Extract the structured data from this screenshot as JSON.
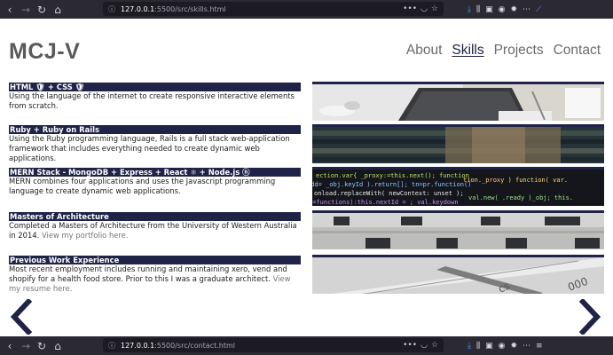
{
  "browser_top": {
    "url_host": "127.0.0.1",
    "url_path": ":5500/src/skills.html"
  },
  "browser_bottom": {
    "url_host": "127.0.0.1",
    "url_path": ":5500/src/contact.html"
  },
  "header": {
    "logo": "MCJ-V"
  },
  "nav": [
    {
      "label": "About"
    },
    {
      "label": "Skills",
      "active": true
    },
    {
      "label": "Projects"
    },
    {
      "label": "Contact"
    }
  ],
  "skills": [
    {
      "title": "HTML 🛡 + CSS 🛡",
      "desc": "Using the language of the internet to create responsive interactive elements from scratch."
    },
    {
      "title": "Ruby + Ruby on Rails",
      "desc": "Using the Ruby programming language, Rails is a full stack web-application framework that includes everything needed to create dynamic web applications."
    },
    {
      "title": "MERN Stack - MongoDB + Express + React ⚛ + Node.js ⓝ",
      "desc": "MERN combines four applications and uses the Javascript programming language to create dynamic web applications."
    },
    {
      "title": "Masters of Architecture",
      "desc": "Completed a Masters of Architecture from the University of Western Australia in 2014.",
      "link": "View my portfolio here."
    },
    {
      "title": "Previous Work Experience",
      "desc": "Most recent employment includes running and maintaining xero, vend and shopify for a health food store. Prior to this I was a graduate architect.",
      "link": "View my resume here."
    }
  ],
  "colors": {
    "accent": "#1f2348",
    "logo": "#5a5a5a",
    "nav": "#6b6b6b",
    "chrome": "#2b2a33"
  },
  "icons": {
    "back": "arrow-left-icon",
    "forward": "arrow-right-icon",
    "reload": "reload-icon",
    "home": "home-icon",
    "prev": "chevron-left-icon",
    "next": "chevron-right-icon"
  }
}
